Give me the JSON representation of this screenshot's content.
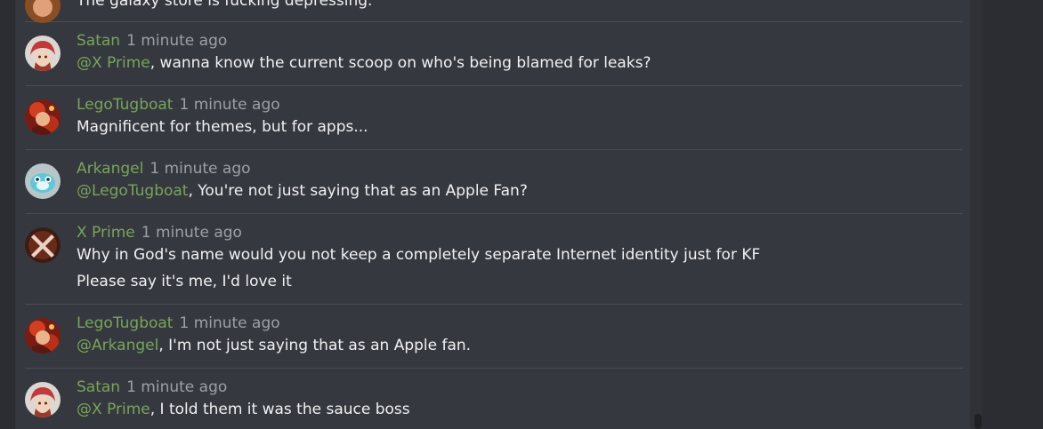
{
  "colors": {
    "background": "#2b2d32",
    "panel": "#36383f",
    "divider": "#4a4c52",
    "username": "#77a55a",
    "mention": "#77a55a",
    "timestamp": "#9da0a6",
    "text": "#f1f1f2"
  },
  "partial_message": {
    "text": "The galaxy store is fucking depressing."
  },
  "messages": [
    {
      "user": "Satan",
      "time": "1 minute ago",
      "avatar_icon": "satan-avatar",
      "lines": [
        {
          "mention": "@X Prime",
          "text": ", wanna know the current scoop on who's being blamed for leaks?"
        }
      ]
    },
    {
      "user": "LegoTugboat",
      "time": "1 minute ago",
      "avatar_icon": "legotugboat-avatar",
      "lines": [
        {
          "mention": "",
          "text": "Magnificent for themes, but for apps..."
        }
      ]
    },
    {
      "user": "Arkangel",
      "time": "1 minute ago",
      "avatar_icon": "arkangel-avatar",
      "lines": [
        {
          "mention": "@LegoTugboat",
          "text": ", You're not just saying that as an Apple Fan?"
        }
      ]
    },
    {
      "user": "X Prime",
      "time": "1 minute ago",
      "avatar_icon": "x-prime-avatar",
      "lines": [
        {
          "mention": "",
          "text": "Why in God's name would you not keep a completely separate Internet identity just for KF"
        },
        {
          "mention": "",
          "text": "Please say it's me, I'd love it"
        }
      ]
    },
    {
      "user": "LegoTugboat",
      "time": "1 minute ago",
      "avatar_icon": "legotugboat-avatar",
      "lines": [
        {
          "mention": "@Arkangel",
          "text": ", I'm not just saying that as an Apple fan."
        }
      ]
    },
    {
      "user": "Satan",
      "time": "1 minute ago",
      "avatar_icon": "satan-avatar",
      "lines": [
        {
          "mention": "@X Prime",
          "text": ", I told them it was the sauce boss"
        }
      ]
    }
  ]
}
